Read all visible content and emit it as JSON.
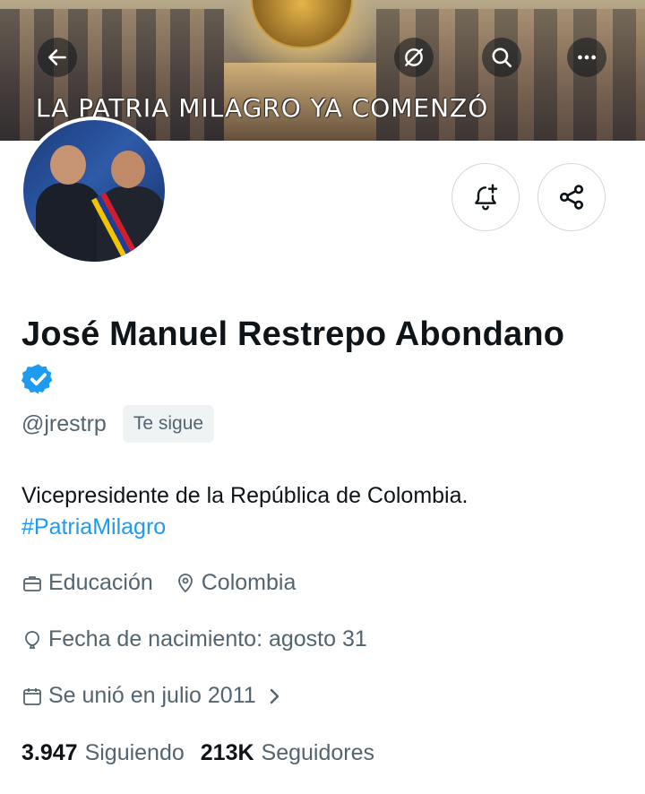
{
  "banner": {
    "text": "LA PATRIA MILAGRO YA COMENZÓ"
  },
  "header": {
    "back_icon": "arrow-left-icon",
    "translate_icon": "circle-slash-icon",
    "search_icon": "search-icon",
    "more_icon": "more-horizontal-icon"
  },
  "actions": {
    "notify_icon": "bell-plus-icon",
    "share_icon": "share-icon"
  },
  "profile": {
    "name": "José Manuel Restrepo Abondano",
    "handle": "@jrestrp",
    "follows_you": "Te sigue",
    "bio_text": "Vicepresidente de la República de Colombia.",
    "bio_hashtag": "#PatriaMilagro",
    "category": "Educación",
    "location": "Colombia",
    "birthday": "Fecha de nacimiento: agosto 31",
    "joined": "Se unió en julio 2011"
  },
  "stats": {
    "following_count": "3.947",
    "following_label": "Siguiendo",
    "followers_count": "213K",
    "followers_label": "Seguidores"
  },
  "colors": {
    "accent": "#1d9bf0",
    "secondary_text": "#536471",
    "primary_text": "#0f1419",
    "border": "#cfd9de"
  }
}
